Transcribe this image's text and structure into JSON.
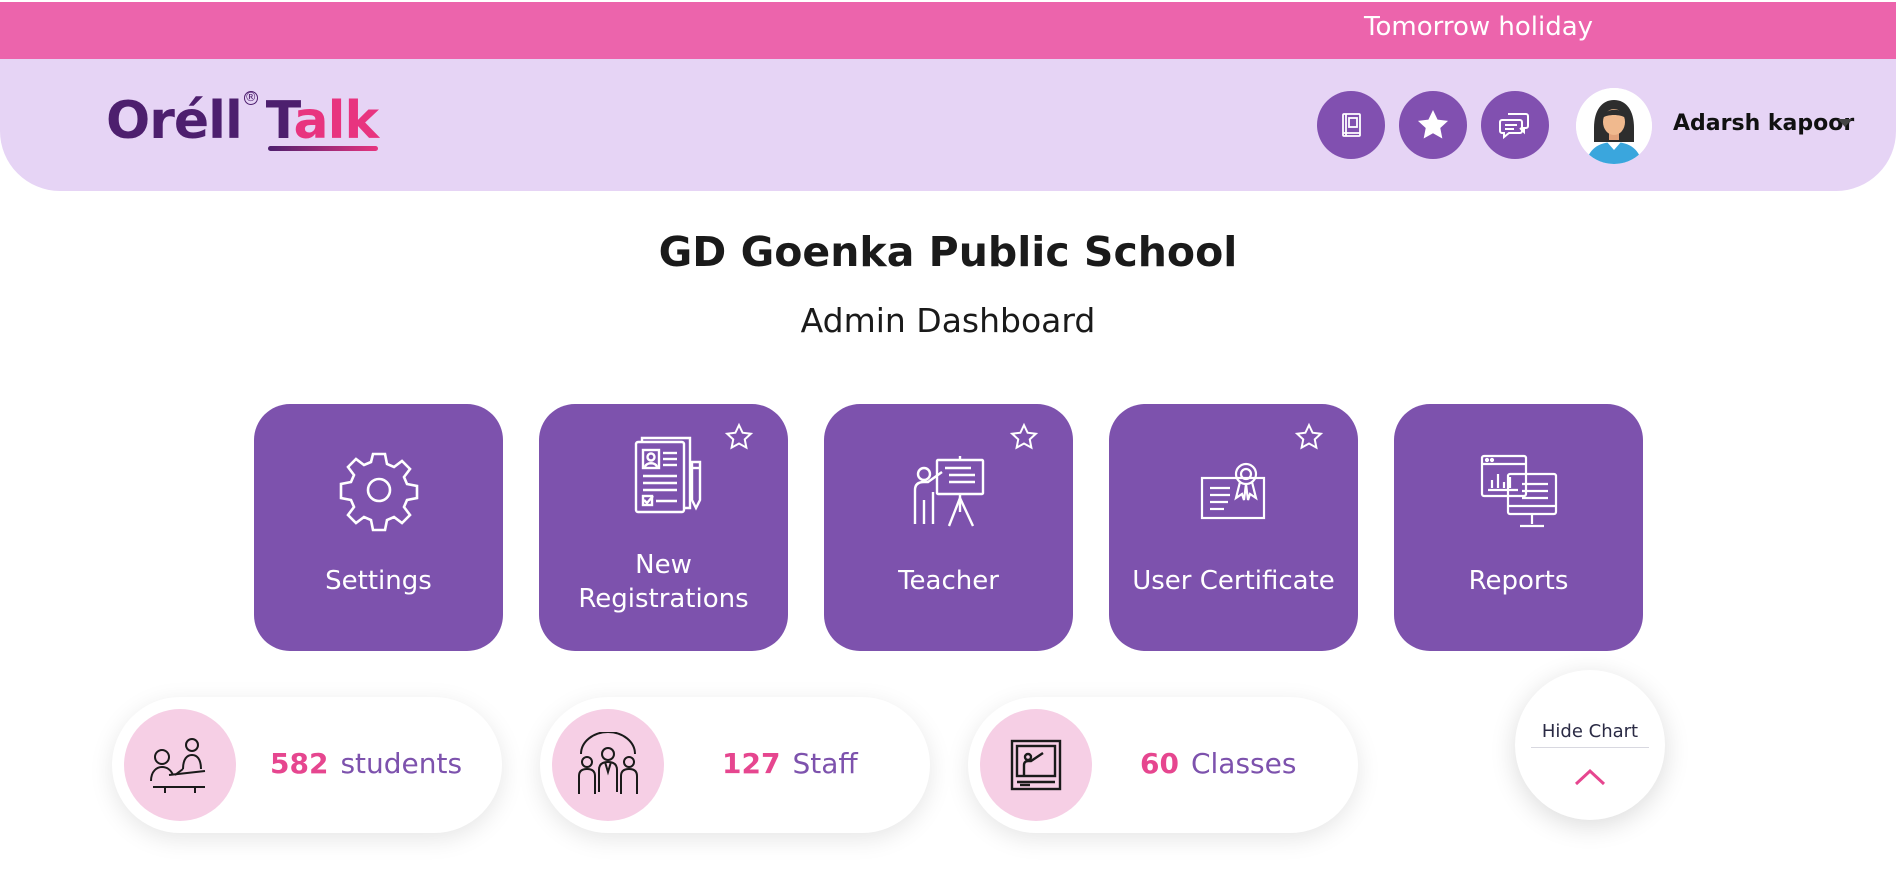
{
  "ticker": {
    "message": "Tomorrow holiday"
  },
  "header": {
    "logo": {
      "part1": "Oréll",
      "part2_a": "T",
      "part2_b": "alk"
    },
    "user_name": "Adarsh kapoor"
  },
  "title": {
    "school": "GD Goenka Public School",
    "dashboard": "Admin Dashboard"
  },
  "tiles": [
    {
      "label": "Settings",
      "icon": "gear-icon",
      "favoritable": false
    },
    {
      "label": "New Registrations",
      "label_line1": "New",
      "label_line2": "Registrations",
      "icon": "registration-form-icon",
      "favoritable": true
    },
    {
      "label": "Teacher",
      "icon": "teacher-presentation-icon",
      "favoritable": true
    },
    {
      "label": "User Certificate",
      "icon": "certificate-icon",
      "favoritable": true
    },
    {
      "label": "Reports",
      "icon": "reports-monitor-icon",
      "favoritable": false
    }
  ],
  "stats": [
    {
      "value": "582",
      "label": "students",
      "icon": "students-desk-icon"
    },
    {
      "value": "127",
      "label": "Staff",
      "icon": "staff-group-icon"
    },
    {
      "value": "60",
      "label": "Classes",
      "icon": "classroom-board-icon"
    }
  ],
  "hide_chart": {
    "label": "Hide Chart",
    "icon": "chevron-up-icon"
  },
  "colors": {
    "ticker": "#ec64ac",
    "header": "#e6d4f5",
    "tile": "#7d52ad",
    "stat_number": "#e6468f",
    "stat_label": "#7d52ad",
    "stat_circle": "#f6cfe5"
  }
}
